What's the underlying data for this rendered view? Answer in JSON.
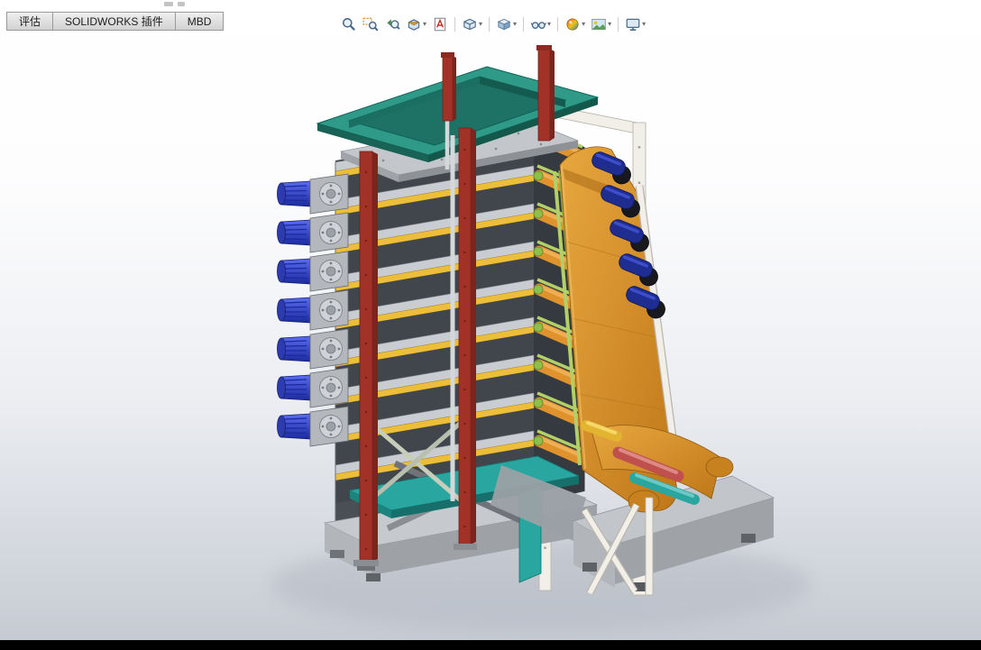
{
  "palette": {
    "frame-teal": "#2f9a88",
    "column-red": "#a23227",
    "belt-orange": "#d98b27",
    "roller-orange": "#e0922d",
    "strip-yellow": "#edbe3a",
    "motor-blue": "#2a3cc0",
    "roller-navy": "#1e2d8f",
    "rail-green": "#b2cf68",
    "accent-teal": "#2aa6a0",
    "steel-light": "#c9ccd0",
    "steel-mid": "#b2b6ba",
    "steel-dark": "#8a8e93",
    "white-frame": "#f1efe7",
    "viewport-top": "#ffffff",
    "viewport-bottom": "#c6cbd3",
    "taskbar-black": "#000000",
    "tab-bg": "#d6d6d6",
    "tab-border": "#9a9a9a"
  },
  "command_tabs": {
    "items": [
      {
        "label": "评估"
      },
      {
        "label": "SOLIDWORKS 插件"
      },
      {
        "label": "MBD"
      }
    ]
  },
  "hud_toolbar": {
    "caret": "▾",
    "items": [
      {
        "name": "zoom-to-fit-icon"
      },
      {
        "name": "zoom-to-area-icon"
      },
      {
        "name": "previous-view-icon"
      },
      {
        "name": "section-view-icon"
      },
      {
        "name": "dynamic-annotation-views-icon"
      },
      {
        "name": "view-orientation-icon"
      },
      {
        "name": "display-style-icon"
      },
      {
        "name": "hide-show-items-icon"
      },
      {
        "name": "edit-appearance-icon"
      },
      {
        "name": "apply-scene-icon"
      },
      {
        "name": "view-settings-icon"
      }
    ]
  }
}
